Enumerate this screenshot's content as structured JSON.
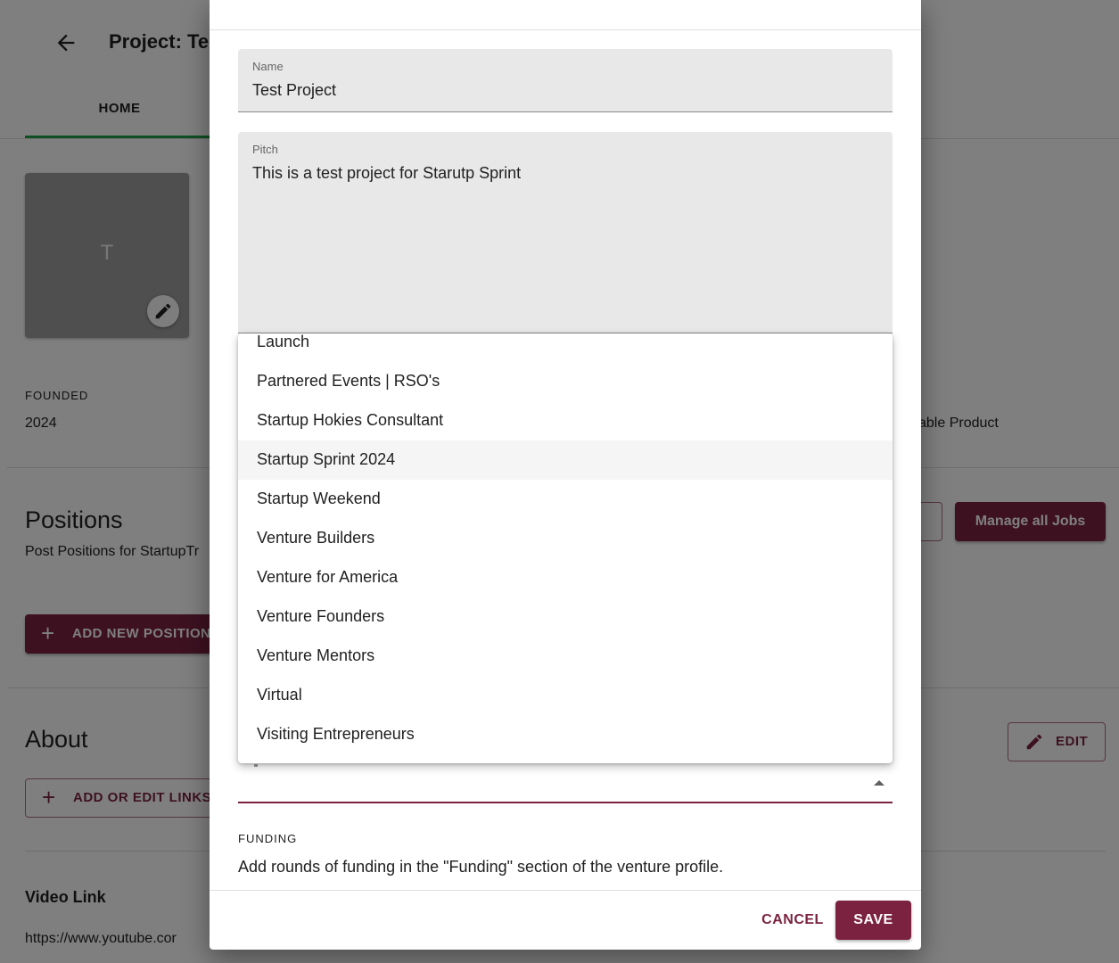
{
  "page": {
    "title": "Project: Te",
    "tabs": [
      {
        "label": "HOME"
      }
    ],
    "logo_letter": "T",
    "founded_label": "FOUNDED",
    "founded_value": "2024",
    "right_fragment": "able Product",
    "positions": {
      "title": "Positions",
      "subtitle": "Post Positions for StartupTr",
      "add_button": "ADD NEW POSITION",
      "manage_jobs_button": "Manage all Jobs"
    },
    "about": {
      "title": "About",
      "add_links_button": "ADD OR EDIT LINKS",
      "edit_button": "EDIT"
    },
    "video": {
      "label": "Video Link",
      "url": "https://www.youtube.cor"
    }
  },
  "dialog": {
    "name_field": {
      "label": "Name",
      "value": "Test Project"
    },
    "pitch_field": {
      "label": "Pitch",
      "value": "This is a test project for Starutp Sprint"
    },
    "dropdown_options": [
      "Launch",
      "Partnered Events | RSO's",
      "Startup Hokies Consultant",
      "Startup Sprint 2024",
      "Startup Weekend",
      "Venture Builders",
      "Venture for America",
      "Venture Founders",
      "Venture Mentors",
      "Virtual",
      "Visiting Entrepreneurs"
    ],
    "highlighted_option": "Startup Sprint 2024",
    "funding": {
      "label": "FUNDING",
      "text": "Add rounds of funding in the \"Funding\" section of the venture profile."
    },
    "cancel_button": "CANCEL",
    "save_button": "SAVE"
  },
  "colors": {
    "accent": "#7b2240",
    "tab_indicator": "#1e9e46",
    "field_bg": "#e8e8e8"
  },
  "icons": {
    "back": "arrow-left-icon",
    "logo_edit": "pencil-icon",
    "add": "plus-icon",
    "edit": "pencil-icon",
    "select": "caret-up-icon"
  }
}
